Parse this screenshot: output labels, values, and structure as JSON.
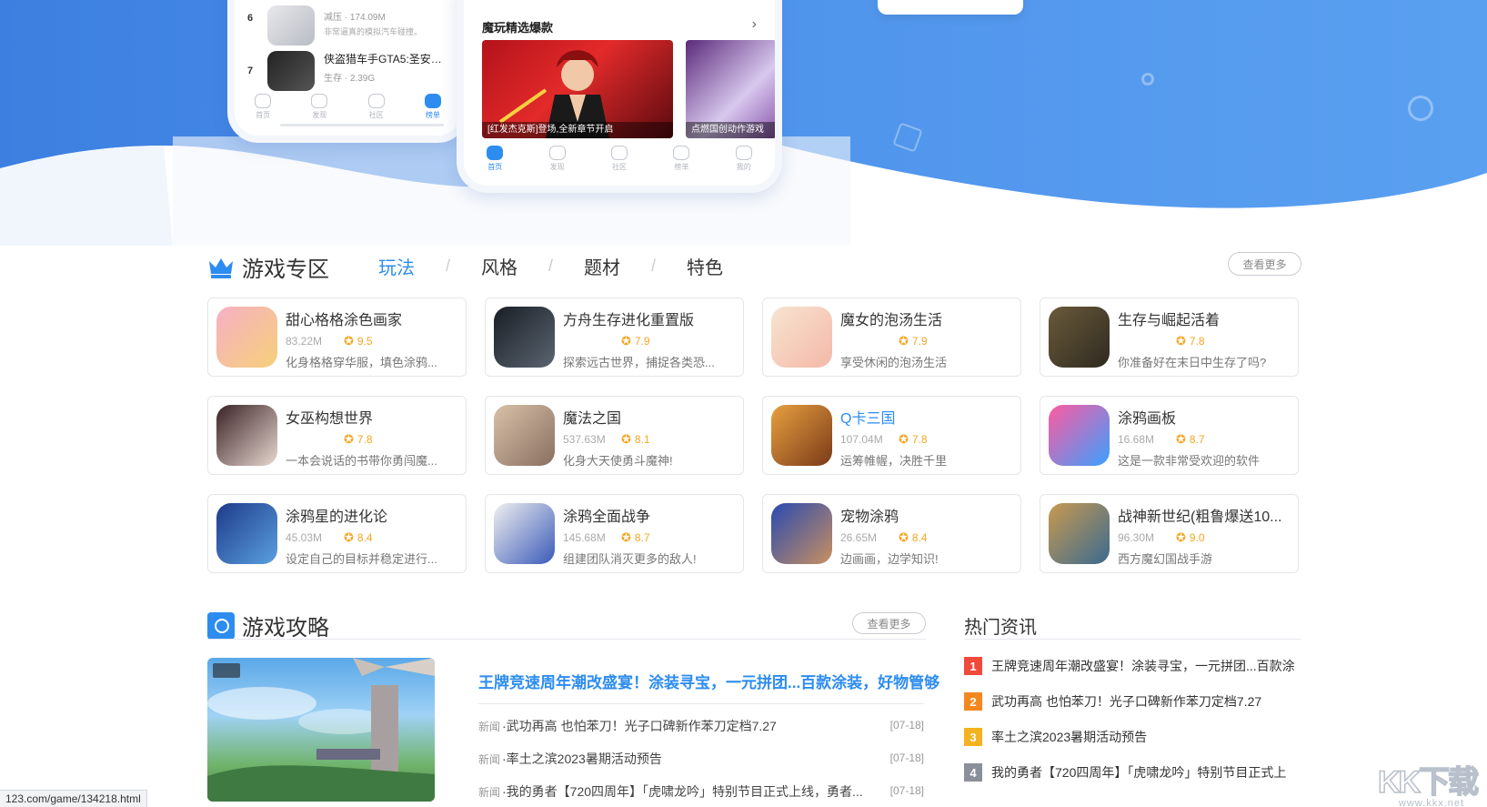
{
  "phones": {
    "ranking": [
      {
        "rank": "6",
        "title": "",
        "meta": "减压 · 174.09M",
        "desc": "非常逼真的模拟汽车碰撞。"
      },
      {
        "rank": "7",
        "title": "侠盗猎车手GTA5:圣安…",
        "meta": "生存 · 2.39G",
        "desc": ""
      }
    ],
    "left_tabs": [
      "首页",
      "发现",
      "社区",
      "榜单"
    ],
    "right_section_title": "魔玩精选爆款",
    "banner_caption": "[红发杰克斯]登场,全新章节开启",
    "banner2_caption": "点燃国创动作游戏",
    "right_tabs": [
      "首页",
      "发现",
      "社区",
      "榜单",
      "我的"
    ]
  },
  "zone": {
    "title": "游戏专区",
    "filters": [
      "玩法",
      "风格",
      "题材",
      "特色"
    ],
    "active_filter": 0,
    "more": "查看更多",
    "games": [
      {
        "name": "甜心格格涂色画家",
        "size": "83.22M",
        "score": "9.5",
        "desc": "化身格格穿华服，填色涂鸦...",
        "icon_colors": [
          "#f7b0c4",
          "#f5d07a"
        ]
      },
      {
        "name": "方舟生存进化重置版",
        "size": "",
        "score": "7.9",
        "desc": "探索远古世界，捕捉各类恐...",
        "icon_colors": [
          "#1a1f26",
          "#5a6470"
        ]
      },
      {
        "name": "魔女的泡汤生活",
        "size": "",
        "score": "7.9",
        "desc": "享受休闲的泡汤生活",
        "icon_colors": [
          "#f7e4d0",
          "#f4b8a8"
        ]
      },
      {
        "name": "生存与崛起活着",
        "size": "",
        "score": "7.8",
        "desc": "你准备好在末日中生存了吗?",
        "icon_colors": [
          "#6a5a3a",
          "#2e2a20"
        ]
      },
      {
        "name": "女巫构想世界",
        "size": "",
        "score": "7.8",
        "desc": "一本会说话的书带你勇闯魔...",
        "icon_colors": [
          "#3a2226",
          "#e8d8d0"
        ]
      },
      {
        "name": "魔法之国",
        "size": "537.63M",
        "score": "8.1",
        "desc": "化身大天使勇斗魔神!",
        "icon_colors": [
          "#d8c0a8",
          "#8a7060"
        ]
      },
      {
        "name": "Q卡三国",
        "size": "107.04M",
        "score": "7.8",
        "desc": "运筹帷幄，决胜千里",
        "icon_colors": [
          "#e8a040",
          "#7a3a18"
        ],
        "link": true
      },
      {
        "name": "涂鸦画板",
        "size": "16.68M",
        "score": "8.7",
        "desc": "这是一款非常受欢迎的软件",
        "icon_colors": [
          "#ff5aa0",
          "#3aa0ff"
        ]
      },
      {
        "name": "涂鸦星的进化论",
        "size": "45.03M",
        "score": "8.4",
        "desc": "设定自己的目标并稳定进行...",
        "icon_colors": [
          "#1e3a8a",
          "#5aa0e0"
        ]
      },
      {
        "name": "涂鸦全面战争",
        "size": "145.68M",
        "score": "8.7",
        "desc": "组建团队消灭更多的敌人!",
        "icon_colors": [
          "#f0f0f0",
          "#3a5ab8"
        ]
      },
      {
        "name": "宠物涂鸦",
        "size": "26.65M",
        "score": "8.4",
        "desc": "边画画，边学知识!",
        "icon_colors": [
          "#2a4ab0",
          "#c89060"
        ]
      },
      {
        "name": "战神新世纪(粗鲁爆送10...",
        "size": "96.30M",
        "score": "9.0",
        "desc": "西方魔幻国战手游",
        "icon_colors": [
          "#c89a50",
          "#3a6a90"
        ]
      }
    ]
  },
  "guide": {
    "title": "游戏攻略",
    "more": "查看更多",
    "feature_title": "王牌竞速周年潮改盛宴！涂装寻宝，一元拼团...百款涂装，好物管够",
    "news": [
      {
        "tag": "新闻",
        "text": "·武功再高 也怕苯刀！光子口碑新作苯刀定档7.27",
        "date": "[07-18]"
      },
      {
        "tag": "新闻",
        "text": "·率土之滨2023暑期活动预告",
        "date": "[07-18]"
      },
      {
        "tag": "新闻",
        "text": "·我的勇者【720四周年】「虎啸龙吟」特别节目正式上线，勇者...",
        "date": "[07-18]"
      }
    ]
  },
  "hot": {
    "title": "热门资讯",
    "items": [
      {
        "num": "1",
        "text": "王牌竞速周年潮改盛宴！涂装寻宝，一元拼团...百款涂",
        "color": "#f04a3a"
      },
      {
        "num": "2",
        "text": "武功再高 也怕苯刀！光子口碑新作苯刀定档7.27",
        "color": "#f5871f"
      },
      {
        "num": "3",
        "text": "率土之滨2023暑期活动预告",
        "color": "#f5b21f"
      },
      {
        "num": "4",
        "text": "我的勇者【720四周年】「虎啸龙吟」特别节目正式上",
        "color": "#8a8f99"
      }
    ]
  },
  "status_url": "123.com/game/134218.html",
  "watermark": {
    "text": "KK下载",
    "url": "www.kkx.net"
  },
  "colors": {
    "accent": "#2d8cf0",
    "star": "#f5a623",
    "hero_blue": "#4a8fe6"
  }
}
